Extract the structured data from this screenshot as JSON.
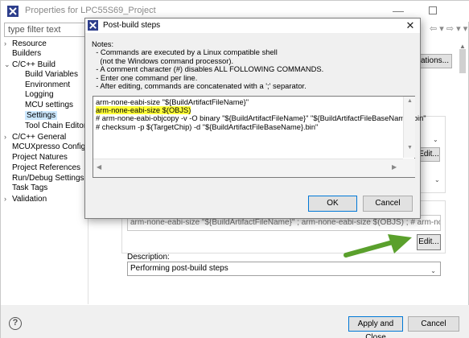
{
  "window": {
    "title": "Properties for LPC55S69_Project",
    "min_glyph": "—"
  },
  "filter": {
    "placeholder": "type filter text"
  },
  "tree": [
    {
      "label": "Resource",
      "arrow": "›"
    },
    {
      "label": "Builders",
      "arrow": ""
    },
    {
      "label": "C/C++ Build",
      "arrow": "⌄"
    },
    {
      "label": "Build Variables",
      "arrow": ""
    },
    {
      "label": "Environment",
      "arrow": ""
    },
    {
      "label": "Logging",
      "arrow": ""
    },
    {
      "label": "MCU settings",
      "arrow": ""
    },
    {
      "label": "Settings",
      "arrow": ""
    },
    {
      "label": "Tool Chain Editor",
      "arrow": ""
    },
    {
      "label": "C/C++ General",
      "arrow": "›"
    },
    {
      "label": "MCUXpresso Config To",
      "arrow": ""
    },
    {
      "label": "Project Natures",
      "arrow": ""
    },
    {
      "label": "Project References",
      "arrow": ""
    },
    {
      "label": "Run/Debug Settings",
      "arrow": ""
    },
    {
      "label": "Task Tags",
      "arrow": ""
    },
    {
      "label": "Validation",
      "arrow": "›"
    }
  ],
  "right": {
    "nav_arrows": "⇦ ▾ ⇨ ▾ ▾",
    "configurations_button": "urations...",
    "edit_label": "Edit...",
    "post_build_command": "arm-none-eabi-size \"${BuildArtifactFileName}\" ; arm-none-eabi-size $(OBJS) ; # arm-none-eabi-obj",
    "post_build_edit": "Edit...",
    "description_label": "Description:",
    "description_value": "Performing post-build steps"
  },
  "buttons": {
    "help": "?",
    "apply_close": "Apply and Close",
    "cancel": "Cancel"
  },
  "dialog": {
    "title": "Post-build steps",
    "close_glyph": "✕",
    "notes": [
      "Notes:",
      "  - Commands are executed by a Linux compatible shell",
      "    (not the Windows command processor).",
      "  - A comment character (#) disables ALL FOLLOWING COMMANDS.",
      "  - Enter one command per line.",
      "  - After editing, commands are concatenated with a ';' separator."
    ],
    "commands": [
      "arm-none-eabi-size \"${BuildArtifactFileName}\"",
      "arm-none-eabi-size $(OBJS)",
      "# arm-none-eabi-objcopy -v -O binary \"${BuildArtifactFileName}\" \"${BuildArtifactFileBaseName}.bin\"",
      "# checksum -p $(TargetChip) -d \"${BuildArtifactFileBaseName}.bin\""
    ],
    "ok": "OK",
    "cancel": "Cancel"
  },
  "colors": {
    "highlight": "#ffff3a",
    "arrow_green": "#5aa02c",
    "default_button_border": "#0078d7"
  }
}
